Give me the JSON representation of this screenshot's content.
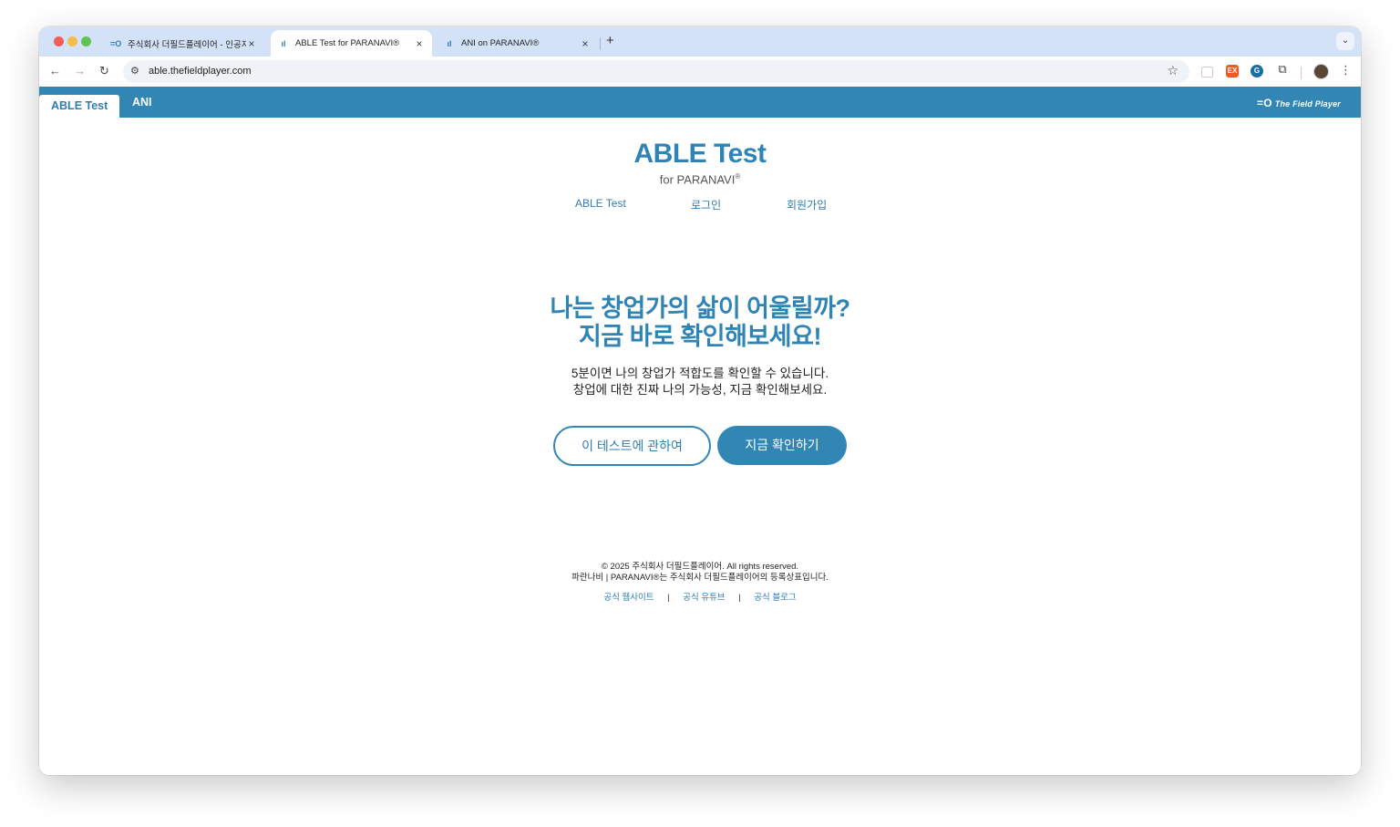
{
  "browser": {
    "tabs": [
      {
        "title": "주식회사 더필드플레이어 - 인공지능",
        "icon": "fieldplayer-logo-icon"
      },
      {
        "title": "ABLE Test for PARANAVI®",
        "icon": "chart-icon"
      },
      {
        "title": "ANI on PARANAVI®",
        "icon": "chart-icon"
      }
    ],
    "url": "able.thefieldplayer.com"
  },
  "appbar": {
    "tabs": [
      "ABLE Test",
      "ANI"
    ],
    "brand": "The Field Player",
    "brand_mark": "=O"
  },
  "hero": {
    "title": "ABLE Test",
    "subtitle": "for PARANAVI",
    "registered_mark": "®"
  },
  "nav_links": [
    "ABLE Test",
    "로그인",
    "회원가입"
  ],
  "headline": {
    "line1": "나는 창업가의 삶이 어울릴까?",
    "line2": "지금 바로 확인해보세요!"
  },
  "description": {
    "line1": "5분이면 나의 창업가 적합도를 확인할 수 있습니다.",
    "line2": "창업에 대한 진짜 나의 가능성, 지금 확인해보세요."
  },
  "buttons": {
    "about": "이 테스트에 관하여",
    "start": "지금 확인하기"
  },
  "footer": {
    "copyright": "© 2025 주식회사 더필드플레이어. All rights reserved.",
    "trademark": "파란나비 | PARANAVI®는 주식회사 더필드플레이어의 등록상표입니다.",
    "links": [
      "공식 웹사이트",
      "공식 유튜브",
      "공식 블로그"
    ],
    "separator": "|"
  },
  "colors": {
    "accent": "#3286b4",
    "tabstrip": "#d3e2f7"
  }
}
